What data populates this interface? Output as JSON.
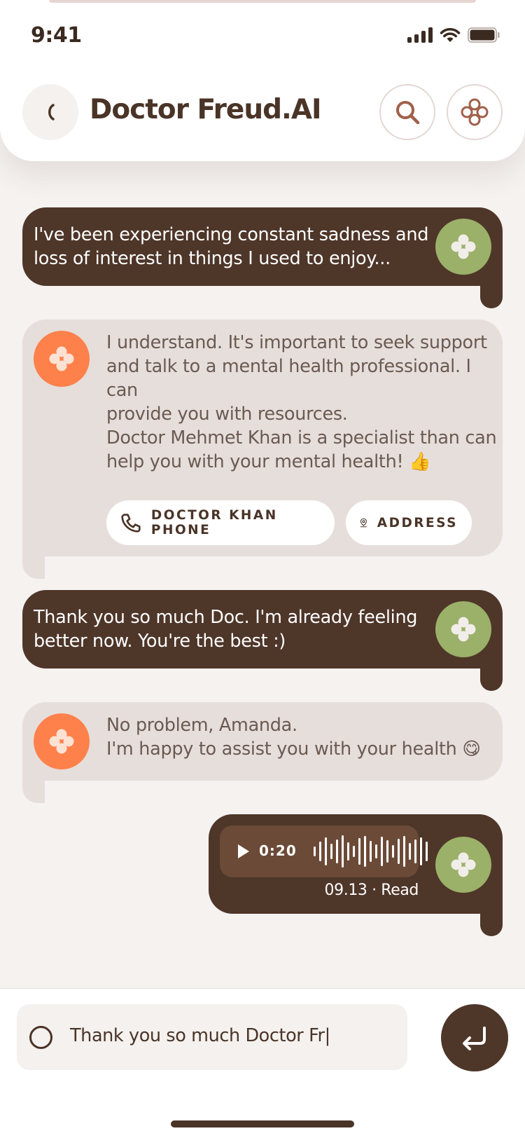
{
  "status_bar": {
    "time": "9:41"
  },
  "header": {
    "title": "Doctor Freud.AI"
  },
  "icons": {
    "back": "chevron-left-icon",
    "search": "search-icon",
    "menu": "four-circles-icon",
    "avatar": "four-dots-icon",
    "phone": "phone-icon",
    "location": "map-pin-icon",
    "play": "play-icon",
    "send": "enter-return-icon"
  },
  "messages": [
    {
      "sender": "user",
      "text_lines": [
        "I've been experiencing constant sadness and",
        "loss of interest in things I used to enjoy..."
      ]
    },
    {
      "sender": "bot",
      "paragraph1_lines": [
        "I understand. It's important to seek support",
        "and talk to a mental health professional. I can",
        "provide you with resources."
      ],
      "paragraph2_lines": [
        "Doctor Mehmet Khan is a specialist than can",
        "help you with your mental health! 👍"
      ],
      "actions": [
        {
          "label": "DOCTOR KHAN PHONE"
        },
        {
          "label": "ADDRESS"
        }
      ]
    },
    {
      "sender": "user",
      "text_lines": [
        "Thank you so much Doc. I'm already feeling",
        "better now. You're the best :)"
      ]
    },
    {
      "sender": "bot",
      "text_lines": [
        "No problem, Amanda.",
        "I'm happy to assist you with your health 😋"
      ]
    },
    {
      "sender": "user",
      "type": "voice",
      "duration": "0:20",
      "meta": "09.13 · Read"
    }
  ],
  "composer": {
    "value": "Thank you so much Doctor Fr|"
  },
  "colors": {
    "brown": "#4e3629",
    "bot_bubble": "#e6dedb",
    "green": "#9bb068",
    "orange": "#fe814b",
    "background": "#f5f2f0"
  }
}
